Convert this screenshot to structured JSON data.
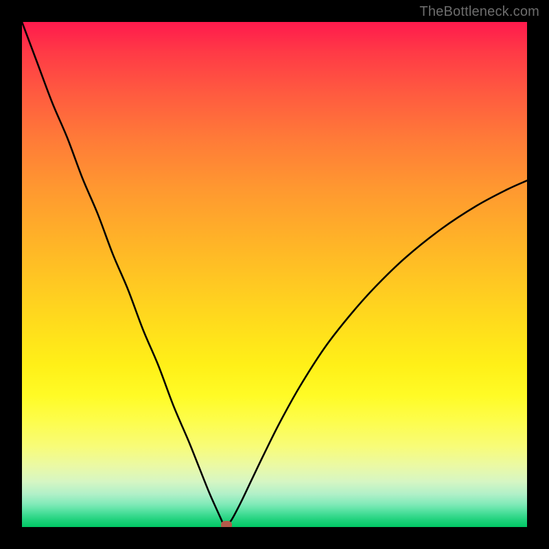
{
  "attribution": "TheBottleneck.com",
  "colors": {
    "frame": "#000000",
    "curve": "#000000",
    "marker": "#b45a4a",
    "gradient_top": "#ff1a4d",
    "gradient_bottom": "#00c864"
  },
  "chart_data": {
    "type": "line",
    "title": "",
    "xlabel": "",
    "ylabel": "",
    "xlim": [
      0,
      100
    ],
    "ylim": [
      0,
      100
    ],
    "grid": false,
    "x": [
      0,
      3,
      6,
      9,
      12,
      15,
      18,
      21,
      24,
      27,
      30,
      33,
      35,
      37,
      38.5,
      39.5,
      40,
      40.5,
      41.2,
      42,
      43.5,
      45.5,
      48,
      51,
      55,
      60,
      65,
      70,
      76,
      83,
      90,
      96,
      100
    ],
    "values": [
      100,
      92,
      84,
      77,
      69,
      62,
      54,
      47,
      39,
      32,
      24,
      17,
      12,
      7,
      3.6,
      1.4,
      0.2,
      0.5,
      1.0,
      2.3,
      5.2,
      9.4,
      14.6,
      20.6,
      27.8,
      35.6,
      42.0,
      47.6,
      53.4,
      59.0,
      63.6,
      66.8,
      68.6
    ],
    "marker": {
      "x": 40.5,
      "y": 0
    },
    "legend": []
  }
}
